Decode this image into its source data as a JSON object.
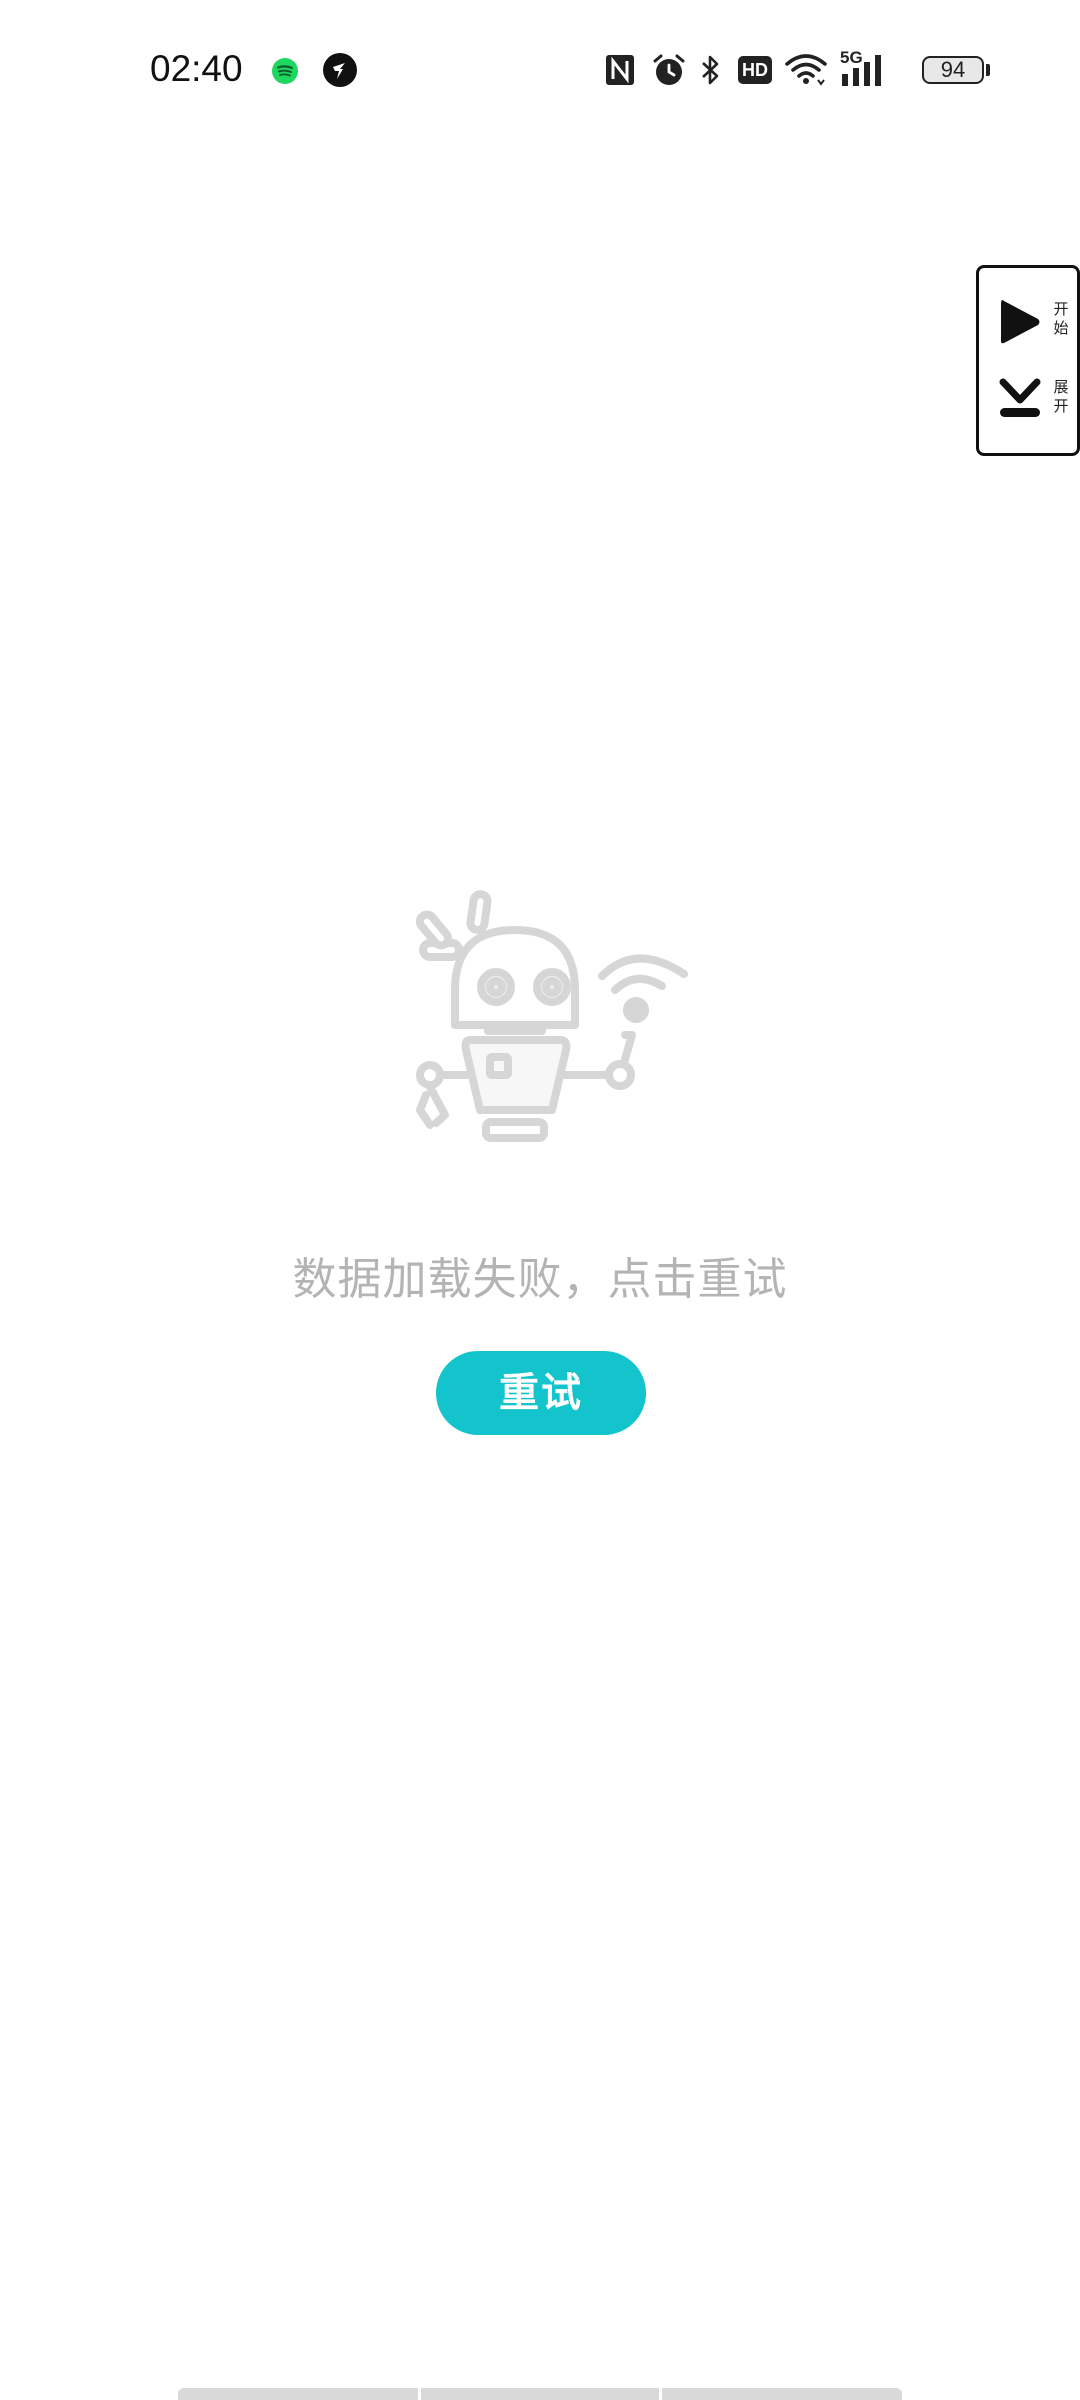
{
  "status_bar": {
    "time": "02:40",
    "battery_level": "94",
    "network_label": "5G",
    "hd_label": "HD",
    "notification_icons": [
      "spotify-icon",
      "messenger-icon"
    ],
    "system_icons": [
      "nfc-icon",
      "alarm-icon",
      "bluetooth-icon",
      "hd-icon",
      "wifi-icon",
      "signal-5g-icon",
      "battery-icon"
    ]
  },
  "floating_widget": {
    "start_label": "开始",
    "expand_label": "展开",
    "start_icon": "play-icon",
    "expand_icon": "collapse-down-icon"
  },
  "empty_state": {
    "illustration": "broken-robot-icon",
    "message": "数据加载失败，点击重试",
    "retry_label": "重试"
  },
  "colors": {
    "accent": "#13c4cc",
    "message_text": "#b4b4b4",
    "background": "#ffffff"
  }
}
